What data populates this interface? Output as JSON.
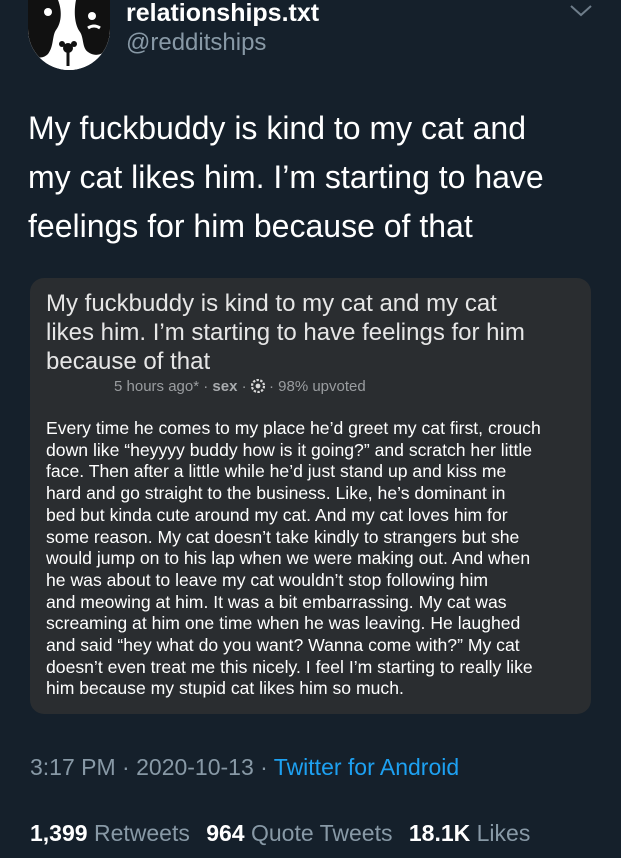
{
  "author": {
    "display_name": "relationships.txt",
    "handle": "@redditships",
    "avatar_icon": "two-faces-avatar-icon"
  },
  "tweet": {
    "text_lines": [
      "My fuckbuddy is kind to my cat and",
      "my cat likes him. I’m starting to have",
      "feelings for him because of that"
    ]
  },
  "embedded_post": {
    "title_lines": [
      "My fuckbuddy is kind to my cat and my cat",
      "likes him. I’m starting to have feelings for him",
      "because of that"
    ],
    "time": "5 hours ago*",
    "subreddit": "sex",
    "award_icon": "gear-award-icon",
    "upvoted": "98% upvoted",
    "body_lines": [
      "Every time he comes to my place he’d greet my cat first, crouch",
      "down like “heyyyy buddy how is it going?” and scratch her little",
      "face. Then after a little while he’d just stand up and kiss me",
      "hard and go straight to the business. Like, he’s dominant in",
      "bed but kinda cute around my cat. And my cat loves him for",
      "some reason. My cat doesn’t take kindly to strangers but she",
      "would jump on to his lap when we were making out. And when",
      "he was about to leave my cat wouldn’t stop following him",
      "and meowing at him. It was a bit embarrassing. My cat was",
      "screaming at him one time when he was leaving. He laughed",
      "and said “hey what do you want? Wanna come with?” My cat",
      "doesn’t even treat me this nicely. I feel I’m starting to really like",
      "him because my stupid cat likes him so much."
    ]
  },
  "meta": {
    "time": "3:17 PM",
    "date": "2020-10-13",
    "source": "Twitter for Android"
  },
  "stats": {
    "retweets_count": "1,399",
    "retweets_label": "Retweets",
    "quotes_count": "964",
    "quotes_label": "Quote Tweets",
    "likes_count": "18.1K",
    "likes_label": "Likes"
  },
  "colors": {
    "background": "#15202b",
    "secondary_text": "#8899a6",
    "link": "#1da1f2",
    "card": "#2a2d30"
  }
}
